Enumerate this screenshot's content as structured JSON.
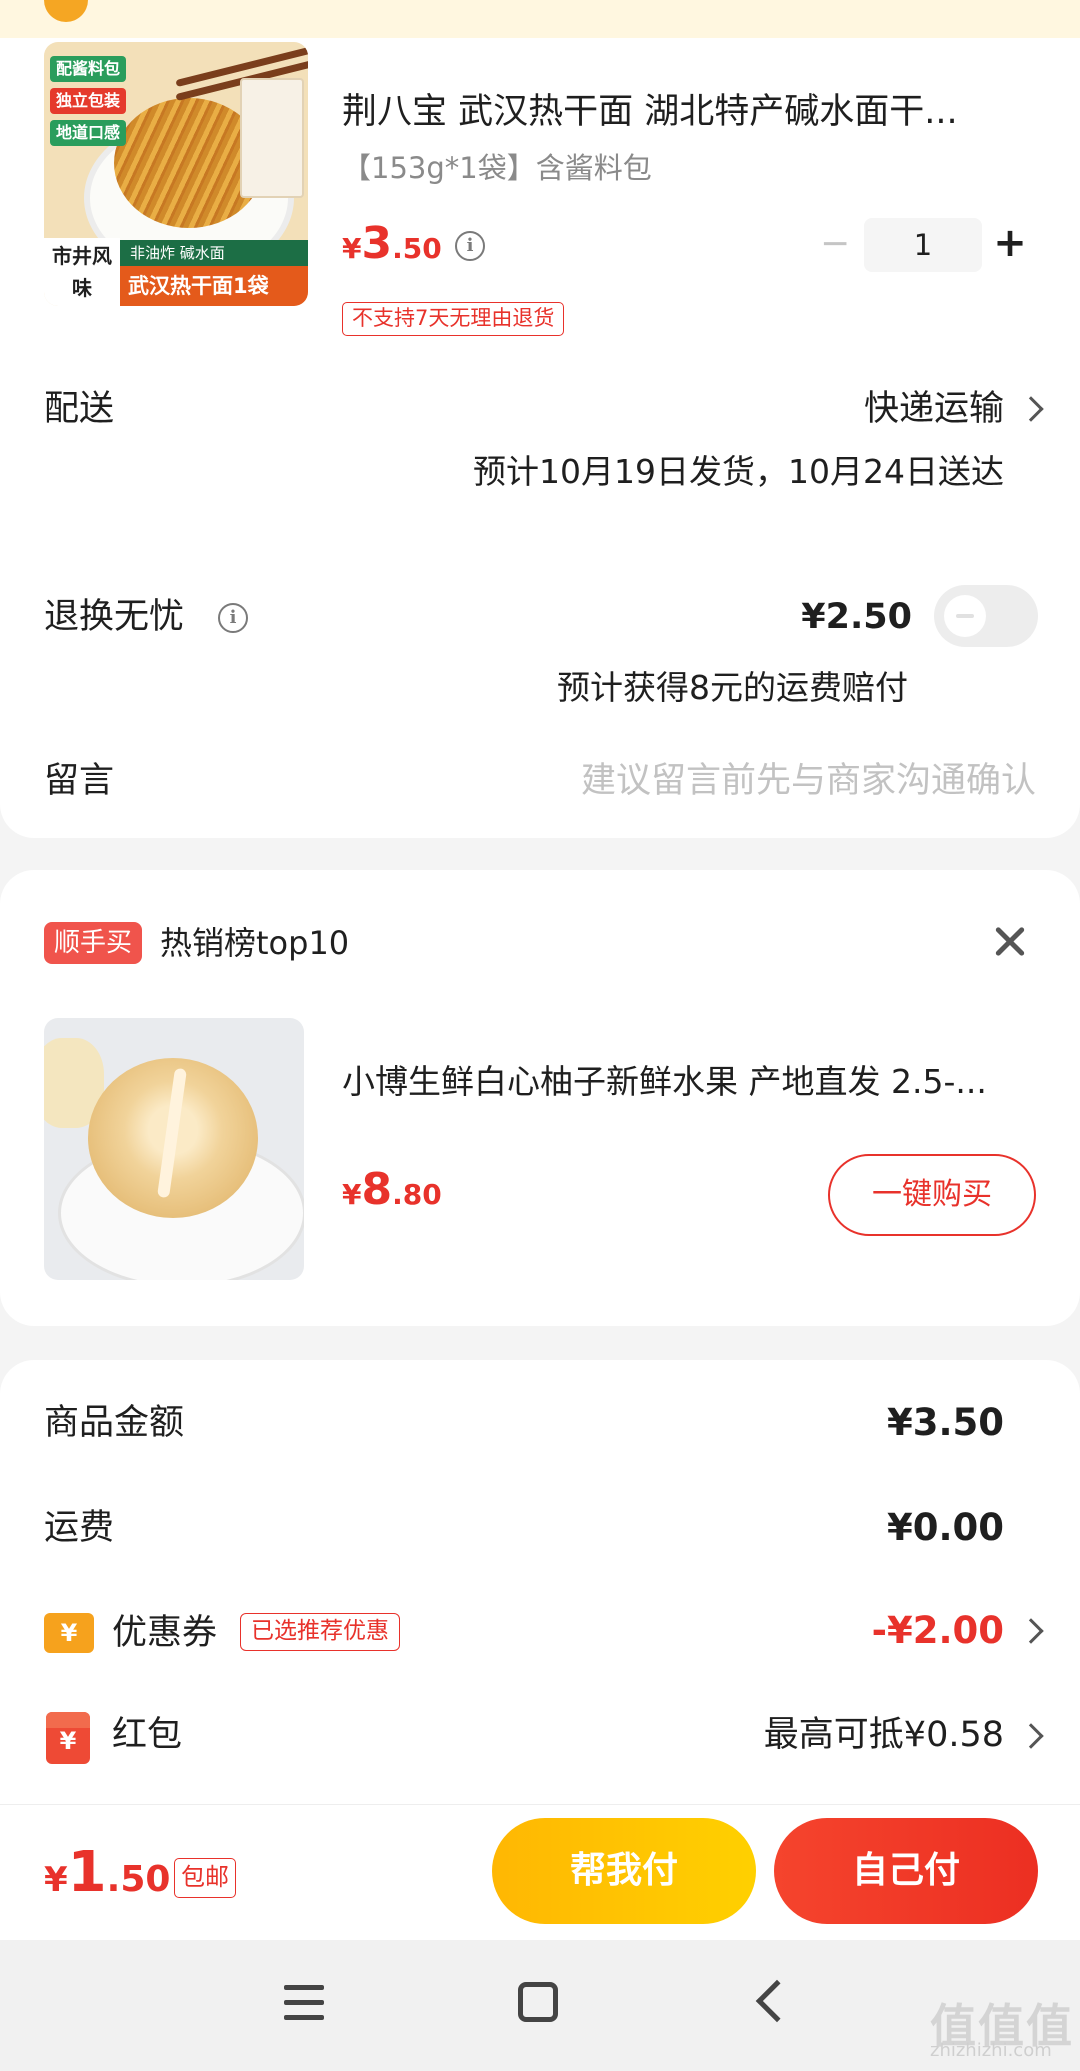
{
  "product": {
    "title": "荆八宝 武汉热干面 湖北特产碱水面干...",
    "spec": "【153g*1袋】含酱料包",
    "price_symbol": "¥",
    "price_int": "3",
    "price_dec": ".50",
    "quantity": "1",
    "return_notice": "不支持7天无理由退货",
    "image": {
      "tags": [
        "配酱料包",
        "独立包装",
        "地道口感"
      ],
      "side_text": "市井风味",
      "strip_text": "非油炸 碱水面",
      "strip_big": "武汉热干面1袋"
    }
  },
  "delivery": {
    "label": "配送",
    "method": "快递运输",
    "estimate": "预计10月19日发货，10月24日送达"
  },
  "return_insurance": {
    "label": "退换无忧",
    "price": "¥2.50",
    "note": "预计获得8元的运费赔付"
  },
  "message": {
    "label": "留言",
    "placeholder": "建议留言前先与商家沟通确认"
  },
  "recommend": {
    "badge": "顺手买",
    "title": "热销榜top10",
    "item": {
      "title": "小博生鲜白心柚子新鲜水果 产地直发 2.5-...",
      "price_symbol": "¥",
      "price_int": "8",
      "price_dec": ".80",
      "buy_label": "一键购买"
    }
  },
  "summary": {
    "goods_label": "商品金额",
    "goods_value": "¥3.50",
    "shipping_label": "运费",
    "shipping_value": "¥0.00",
    "coupon_icon": "¥",
    "coupon_label": "优惠券",
    "coupon_tag": "已选推荐优惠",
    "coupon_value": "-¥2.00",
    "hongbao_icon": "¥",
    "hongbao_label": "红包",
    "hongbao_value": "最高可抵¥0.58"
  },
  "checkout": {
    "total_symbol": "¥",
    "total_int": "1",
    "total_dec": ".50",
    "free_shipping": "包邮",
    "help_pay": "帮我付",
    "self_pay": "自己付"
  },
  "colors": {
    "accent": "#e8322b",
    "yellow": "#ffc400"
  },
  "watermark": {
    "text": "值值值",
    "sub": "zhizhizhi.com"
  }
}
